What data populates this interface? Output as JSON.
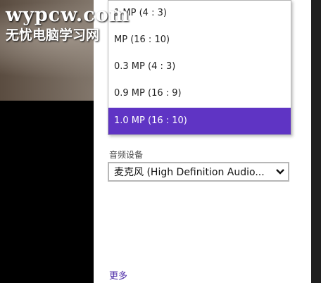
{
  "watermark": {
    "domain": "wypcw.com",
    "site_name": "无忧电脑学习网"
  },
  "resolution_dropdown": {
    "options": [
      "1 MP (4 : 3)",
      "MP (16 : 10)",
      "0.3 MP (4 : 3)",
      "0.9 MP (16 : 9)",
      "1.0 MP (16 : 10)"
    ],
    "selected_index": 4
  },
  "audio": {
    "label": "音频设备",
    "value": "麦克风 (High Definition Audio..."
  },
  "more_link": "更多",
  "colors": {
    "selected_bg": "#5f34c4",
    "link": "#4f2ea8"
  },
  "icons": {
    "select_arrow": "chevron-down-icon"
  }
}
